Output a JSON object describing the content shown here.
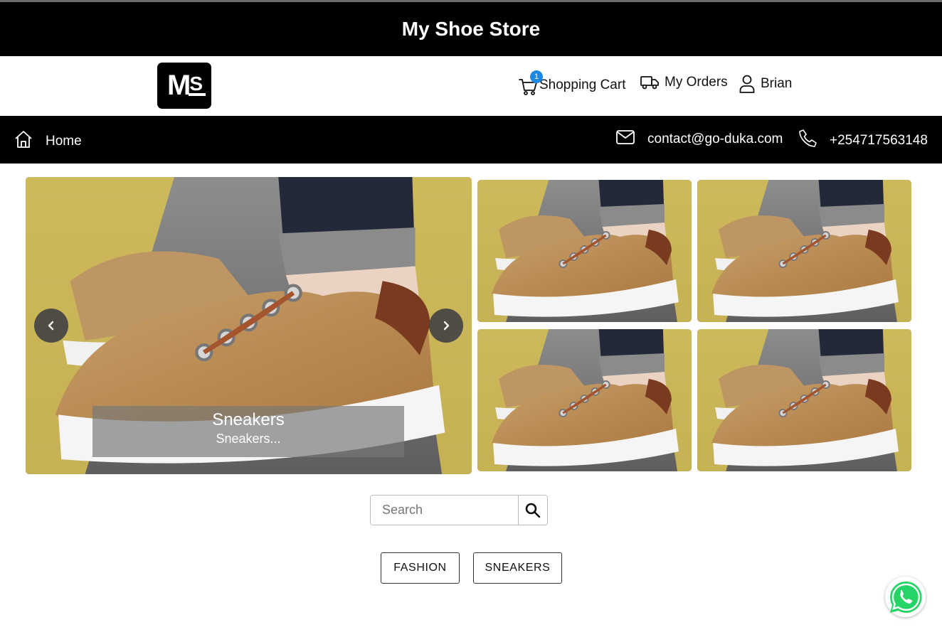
{
  "store": {
    "title": "My Shoe Store",
    "logo_text": "MS"
  },
  "header": {
    "cart_label": "Shopping Cart",
    "cart_count": "1",
    "orders_label": "My Orders",
    "user_label": "Brian"
  },
  "navbar": {
    "home_label": "Home",
    "email": "contact@go-duka.com",
    "phone": "+254717563148"
  },
  "carousel": {
    "caption_title": "Sneakers",
    "caption_subtitle": "Sneakers..."
  },
  "search": {
    "placeholder": "Search"
  },
  "categories": [
    "FASHION",
    "SNEAKERS"
  ],
  "icons": {
    "cart": "shopping-cart-icon",
    "orders": "truck-icon",
    "user": "user-icon",
    "home": "home-icon",
    "email": "envelope-icon",
    "phone": "phone-icon",
    "search": "magnifier-icon",
    "whatsapp": "whatsapp-icon"
  },
  "colors": {
    "bar": "#000000",
    "badge": "#1e88e5",
    "whatsapp": "#25d366"
  }
}
